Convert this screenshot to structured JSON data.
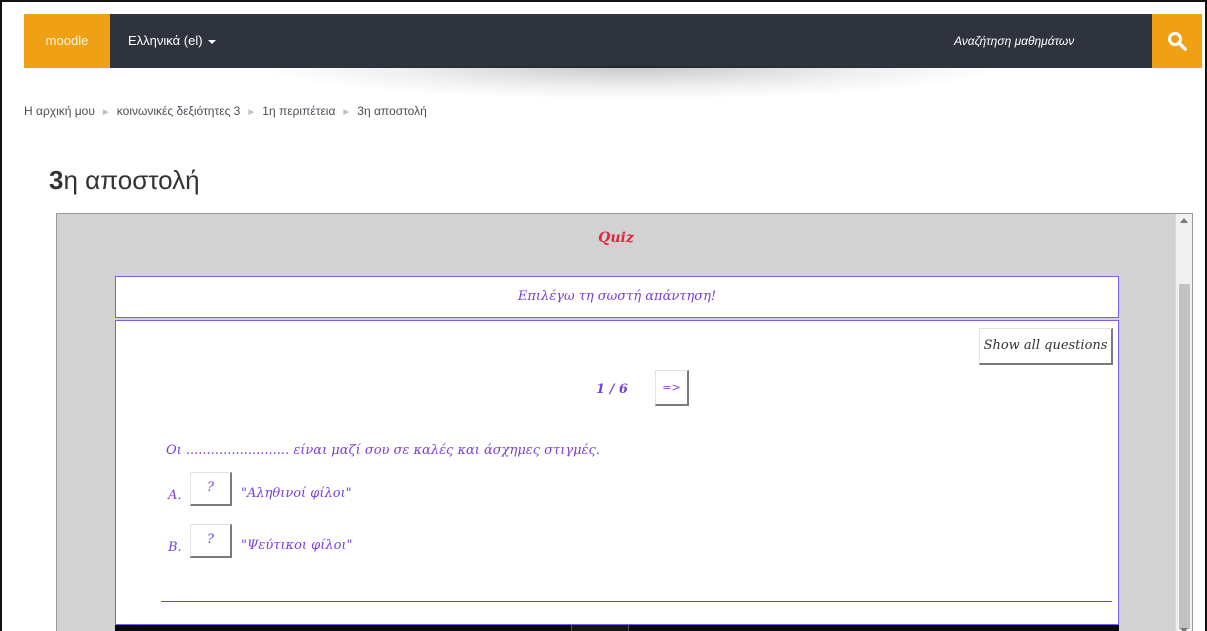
{
  "navbar": {
    "brand": "moodle",
    "language": "Ελληνικά (el)",
    "search_label": "Αναζήτηση μαθημάτων"
  },
  "breadcrumb": {
    "items": [
      "Η αρχική μου",
      "κοινωνικές δεξιότητες 3",
      "1η περιπέτεια",
      "3η αποστολή"
    ]
  },
  "page": {
    "title_prefix": "3",
    "title_rest": "η αποστολή"
  },
  "activity": {
    "quiz_title": "Quiz",
    "instruction": "Επιλέγω τη σωστή απάντηση!",
    "show_all_label": "Show all questions",
    "counter": "1 / 6",
    "next_label": "=>",
    "question": "Οι ......................... είναι μαζί σου σε καλές και άσχημες στιγμές.",
    "options": [
      {
        "letter": "A.",
        "button": "?",
        "text": "\"Αληθινοί φίλοι\""
      },
      {
        "letter": "B.",
        "button": "?",
        "text": "\"Ψεύτικοι φίλοι\""
      }
    ]
  },
  "colors": {
    "accent": "#f0a014",
    "navbar": "#2e333d",
    "quiz_text": "#7a3fd6",
    "quiz_title": "#e3243b"
  }
}
